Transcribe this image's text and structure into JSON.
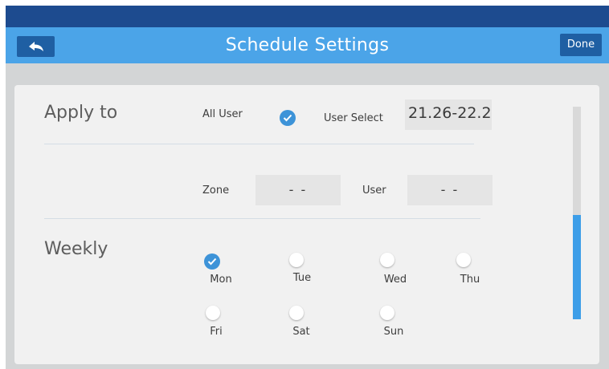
{
  "header": {
    "title": "Schedule Settings",
    "done_label": "Done"
  },
  "apply_to": {
    "heading": "Apply to",
    "all_user_label": "All User",
    "all_user_checked": true,
    "user_select_label": "User Select",
    "user_select_value": "21.26-22.2",
    "zone_label": "Zone",
    "zone_value": "- -",
    "user_label": "User",
    "user_value": "- -"
  },
  "weekly": {
    "heading": "Weekly",
    "days": [
      {
        "label": "Mon",
        "checked": true
      },
      {
        "label": "Tue",
        "checked": false
      },
      {
        "label": "Wed",
        "checked": false
      },
      {
        "label": "Thu",
        "checked": false
      },
      {
        "label": "Fri",
        "checked": false
      },
      {
        "label": "Sat",
        "checked": false
      },
      {
        "label": "Sun",
        "checked": false
      }
    ]
  },
  "colors": {
    "header_bar": "#4ba4e8",
    "status_bar": "#1d4b8f",
    "accent": "#3d93d8"
  },
  "icons": {
    "back": "back-arrow-icon",
    "check": "checkmark-icon"
  }
}
